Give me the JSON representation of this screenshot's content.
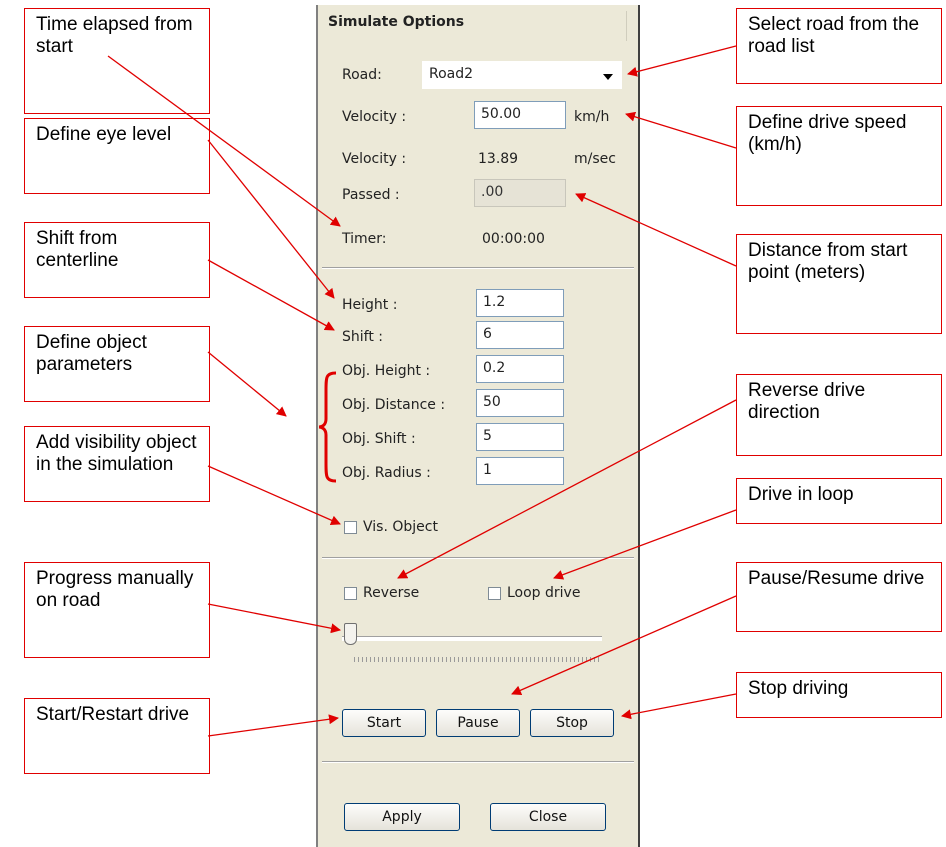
{
  "dialog": {
    "title": "Simulate Options",
    "road": {
      "label": "Road:",
      "value": "Road2"
    },
    "velocity_kmh": {
      "label": "Velocity :",
      "value": "50.00",
      "unit": "km/h"
    },
    "velocity_ms": {
      "label": "Velocity :",
      "value": "13.89",
      "unit": "m/sec"
    },
    "passed": {
      "label": "Passed :",
      "value": ".00"
    },
    "timer": {
      "label": "Timer:",
      "value": "00:00:00"
    },
    "height": {
      "label": "Height :",
      "value": "1.2"
    },
    "shift": {
      "label": "Shift :",
      "value": "6"
    },
    "obj_height": {
      "label": "Obj. Height :",
      "value": "0.2"
    },
    "obj_distance": {
      "label": "Obj. Distance :",
      "value": "50"
    },
    "obj_shift": {
      "label": "Obj. Shift :",
      "value": "5"
    },
    "obj_radius": {
      "label": "Obj. Radius :",
      "value": "1"
    },
    "vis_object": {
      "label": "Vis. Object",
      "checked": false
    },
    "reverse": {
      "label": "Reverse",
      "checked": false
    },
    "loop_drive": {
      "label": "Loop drive",
      "checked": false
    },
    "progress_slider": {
      "value": 0
    },
    "buttons": {
      "start": "Start",
      "pause": "Pause",
      "stop": "Stop",
      "apply": "Apply",
      "close": "Close"
    }
  },
  "annotations": {
    "time_elapsed": "Time elapsed from start",
    "eye_level": "Define eye level",
    "shift_centerline": "Shift from centerline",
    "object_params": "Define object parameters",
    "visibility_object": "Add visibility object in the simulation",
    "progress_manual": "Progress manually on road",
    "start_restart": "Start/Restart drive",
    "select_road": "Select road from the road list",
    "drive_speed": "Define drive speed (km/h)",
    "distance_start": "Distance from start point (meters)",
    "reverse_direction": "Reverse drive direction",
    "drive_loop": "Drive in loop",
    "pause_resume": "Pause/Resume drive",
    "stop_driving": "Stop driving"
  },
  "colors": {
    "annotation": "#e00000",
    "panel_bg": "#ece9d8",
    "button_border": "#003c74"
  }
}
